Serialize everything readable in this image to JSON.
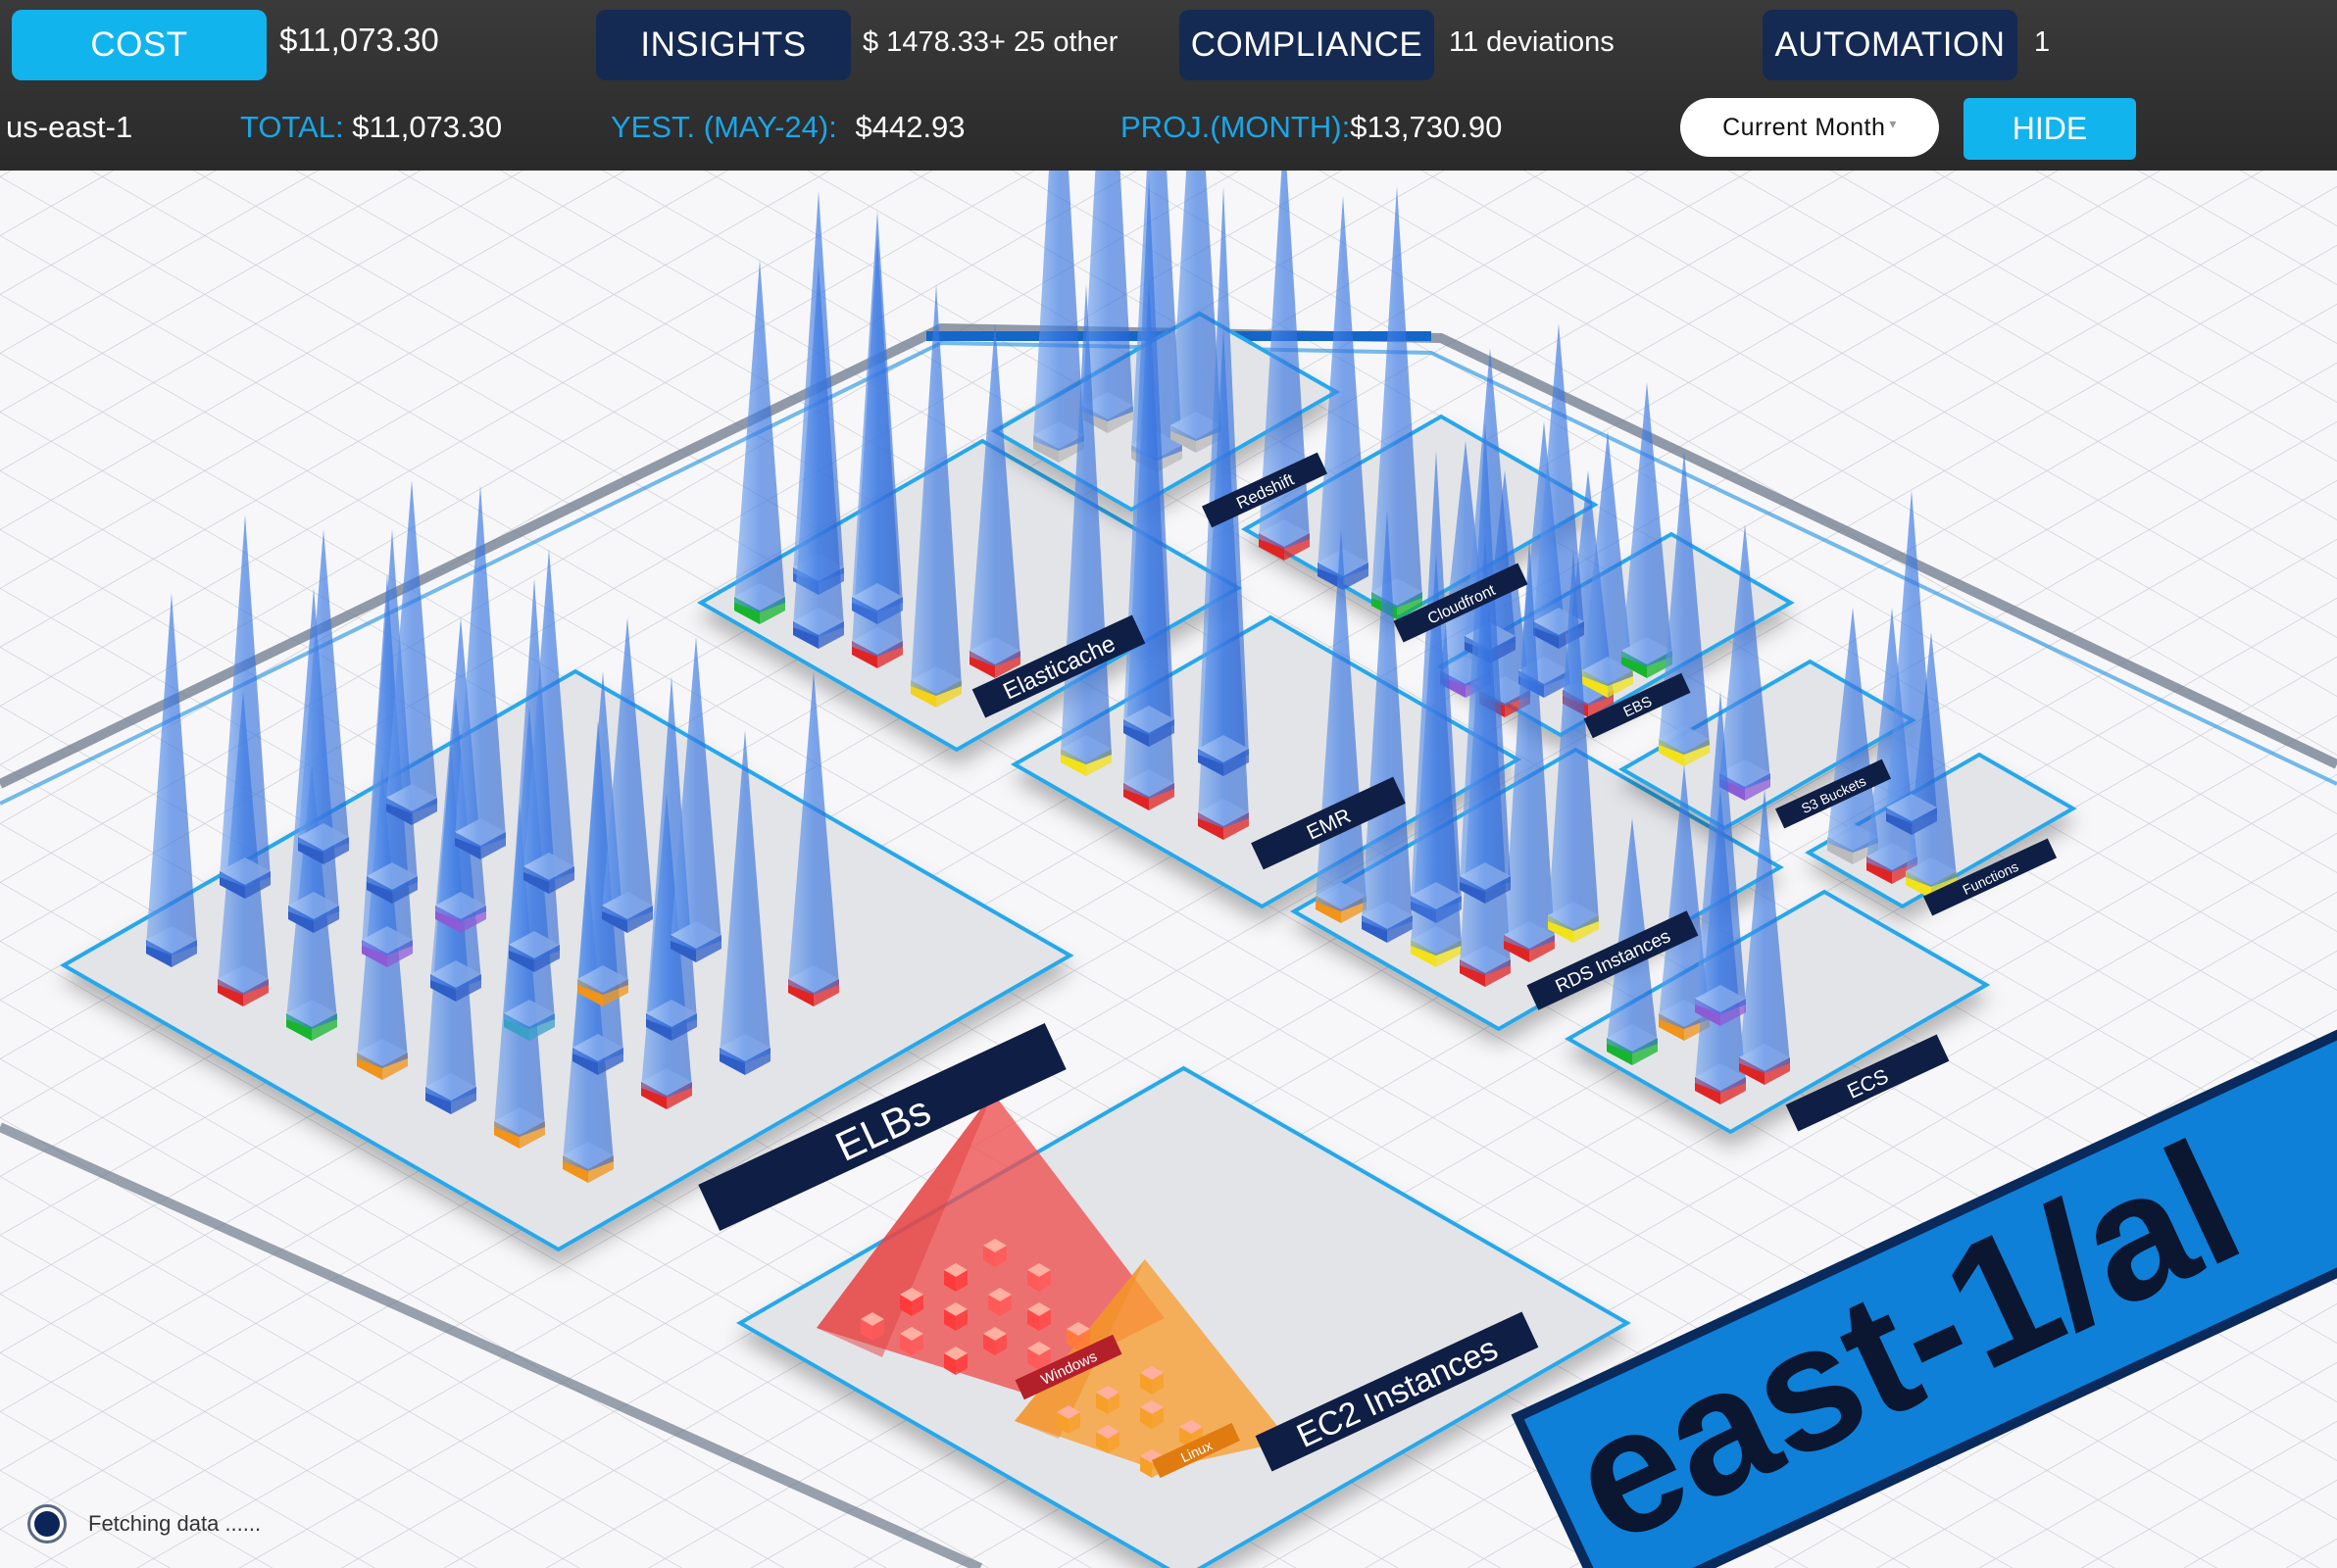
{
  "topbar": {
    "tabs": [
      {
        "label": "COST",
        "value": "$11,073.30"
      },
      {
        "label": "INSIGHTS",
        "value": "$ 1478.33+ 25 other"
      },
      {
        "label": "COMPLIANCE",
        "value": "11 deviations"
      },
      {
        "label": "AUTOMATION",
        "value": "1"
      }
    ],
    "region": "us-east-1",
    "total_label": "TOTAL:",
    "total_value": "$11,073.30",
    "yest_label": "YEST. (MAY-24):",
    "yest_value": "$442.93",
    "proj_label": "PROJ.(MONTH):",
    "proj_value": "$13,730.90",
    "period": "Current Month",
    "hide_label": "HIDE"
  },
  "scene": {
    "groups": {
      "elbs": "ELBs",
      "ec2": "EC2 Instances",
      "windows": "Windows",
      "linux": "Linux",
      "elasticache": "Elasticache",
      "redshift": "Redshift",
      "cloudfront": "Cloudfront",
      "emr": "EMR",
      "ebs": "EBS",
      "rds": "RDS Instances",
      "s3": "S3 Buckets",
      "functions": "Functions",
      "ecs": "ECS"
    },
    "region_banner": "east-1/al"
  },
  "status": {
    "text": "Fetching data ......"
  },
  "colors": {
    "accent": "#12b4ee",
    "tab_dark": "#142a52",
    "label_blue": "#1aa6e8",
    "spike": "#3f7fe6",
    "ec2_red": "#f05050",
    "ec2_orange": "#f7a030"
  }
}
